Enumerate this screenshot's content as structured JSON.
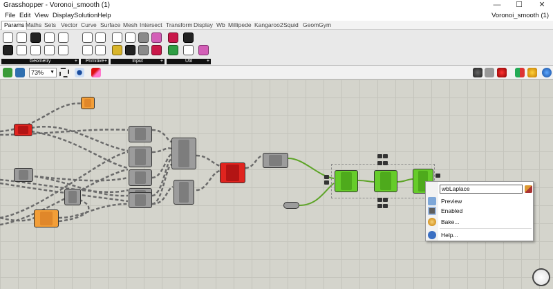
{
  "window": {
    "title": "Grasshopper - Voronoi_smooth (1)",
    "minimize": "—",
    "maximize": "☐",
    "close": "✕"
  },
  "menu": {
    "items": [
      "File",
      "Edit",
      "View",
      "Display",
      "Solution",
      "Help"
    ],
    "document_name": "Voronoi_smooth (1)"
  },
  "tabs": [
    "Params",
    "Maths",
    "Sets",
    "Vector",
    "Curve",
    "Surface",
    "Mesh",
    "Intersect",
    "Transform",
    "Display",
    "Wb",
    "Millipede",
    "Kangaroo2",
    "Squid",
    "GeomGym"
  ],
  "active_tab": "Params",
  "ribbon_groups": [
    {
      "label": "Geometry",
      "plus": "+"
    },
    {
      "label": "Primitive",
      "plus": "+"
    },
    {
      "label": "Input",
      "plus": "+"
    },
    {
      "label": "Util",
      "plus": "+"
    }
  ],
  "toolbar": {
    "zoom": "73%"
  },
  "canvas": {
    "component_label": "wbLaplace"
  },
  "context_menu": {
    "name_value": "wbLaplace",
    "items": [
      {
        "label": "Preview",
        "icon": "preview-icon"
      },
      {
        "label": "Enabled",
        "icon": "enabled-icon"
      },
      {
        "label": "Bake...",
        "icon": "bake-icon"
      },
      {
        "label": "Help...",
        "icon": "help-icon"
      }
    ]
  },
  "colors": {
    "canvas": "#d4d4cc",
    "component_grey": "#9c9c9c",
    "component_red": "#e0241f",
    "component_orange": "#f29e38",
    "component_green": "#66cc2a"
  }
}
